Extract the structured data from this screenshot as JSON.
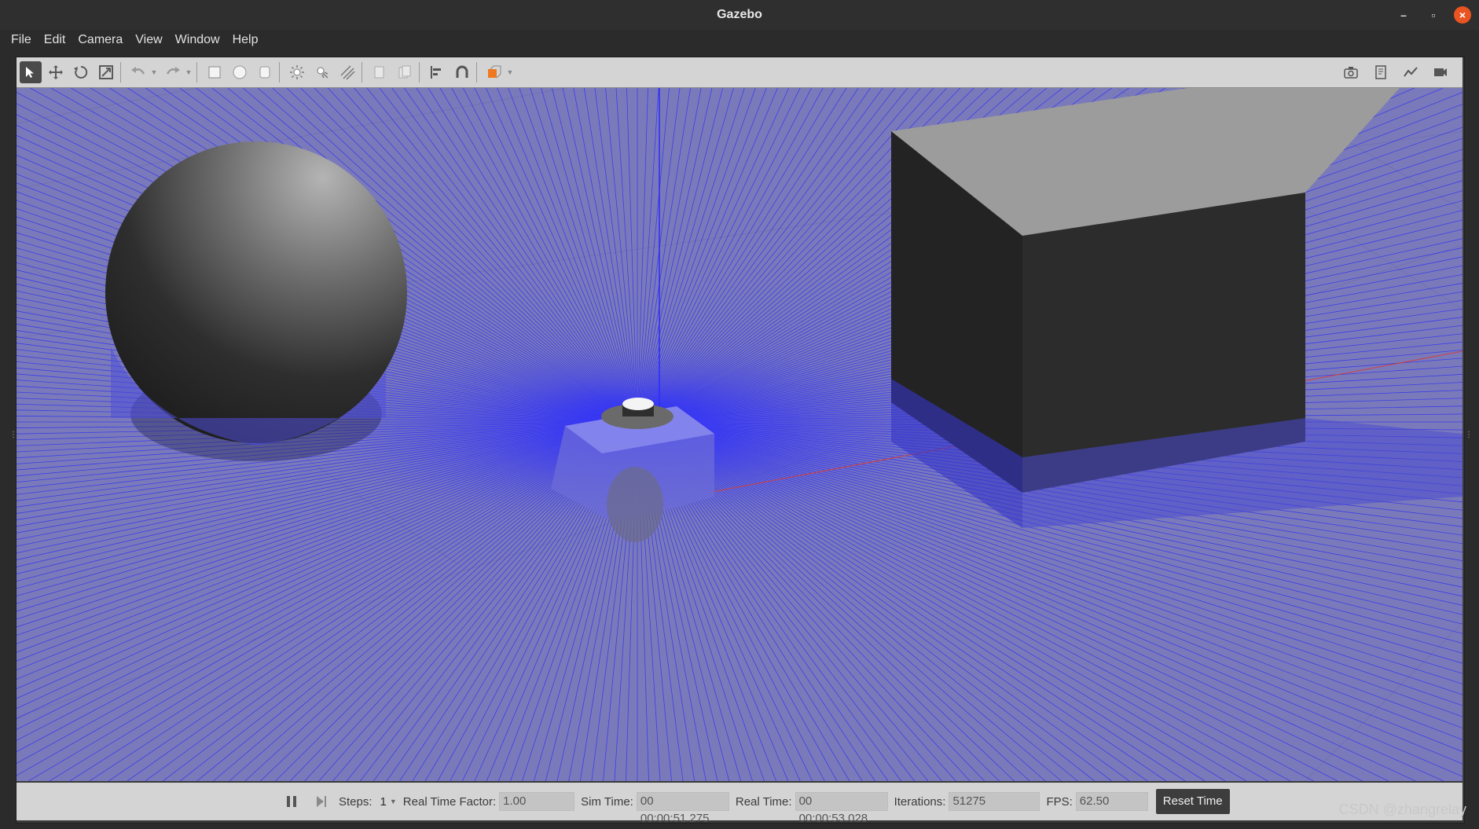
{
  "window": {
    "title": "Gazebo"
  },
  "menu": {
    "items": [
      "File",
      "Edit",
      "Camera",
      "View",
      "Window",
      "Help"
    ]
  },
  "toolbar": {
    "icons": [
      "select-icon",
      "translate-icon",
      "rotate-icon",
      "scale-icon",
      "undo-icon",
      "redo-icon",
      "box-icon",
      "sphere-icon",
      "cylinder-icon",
      "point-light-icon",
      "spot-light-icon",
      "directional-light-icon",
      "copy-icon",
      "paste-icon",
      "align-icon",
      "snap-icon",
      "view-angle-icon"
    ],
    "right_icons": [
      "screenshot-icon",
      "log-icon",
      "plot-icon",
      "record-icon"
    ]
  },
  "status": {
    "steps_label": "Steps:",
    "steps_value": "1",
    "rtf_label": "Real Time Factor:",
    "rtf_value": "1.00",
    "sim_time_label": "Sim Time:",
    "sim_time_value": "00 00:00:51.275",
    "real_time_label": "Real Time:",
    "real_time_value": "00 00:00:53.028",
    "iterations_label": "Iterations:",
    "iterations_value": "51275",
    "fps_label": "FPS:",
    "fps_value": "62.50",
    "reset_label": "Reset Time"
  },
  "watermark": "CSDN @zhangrelay",
  "colors": {
    "laser": "#2f2ff0",
    "ground": "#8e8e8e",
    "accent": "#e95420"
  }
}
